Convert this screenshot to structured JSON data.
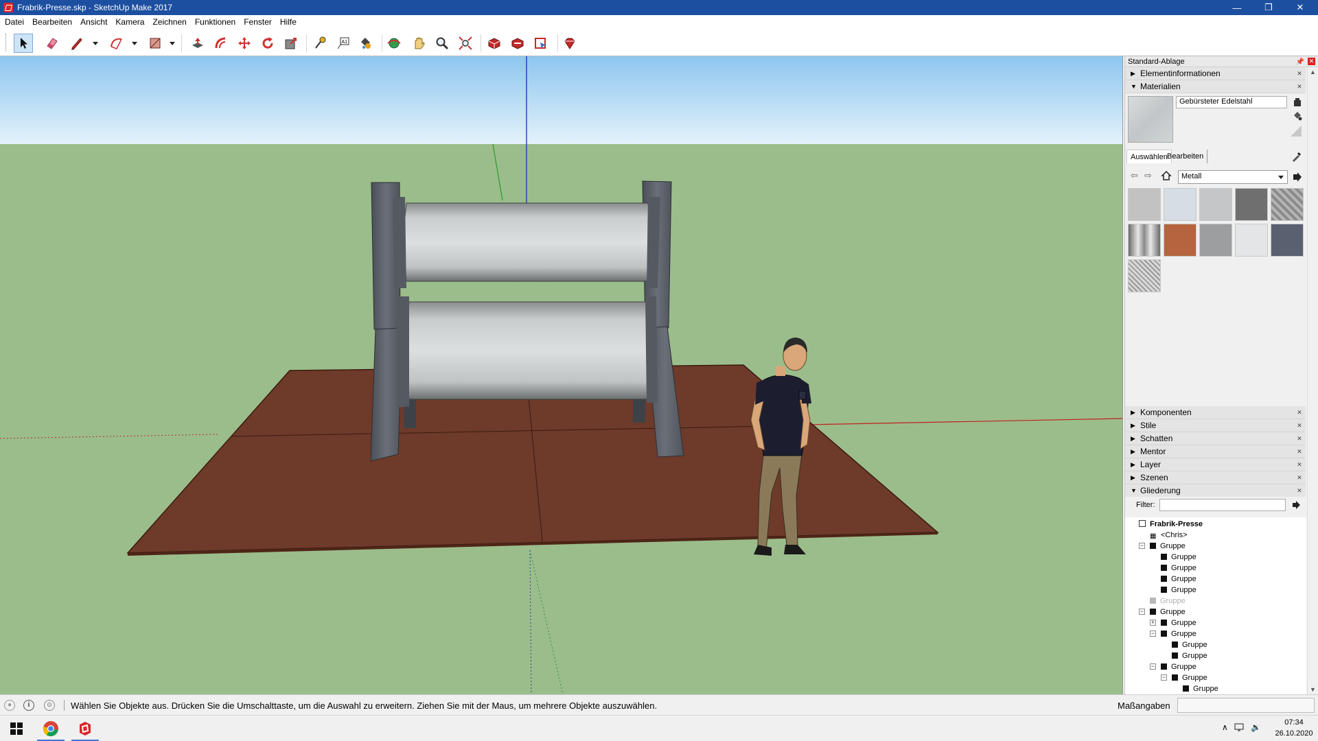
{
  "window": {
    "title": "Frabrik-Presse.skp - SketchUp Make 2017",
    "controls": {
      "minimize": "—",
      "restore": "❐",
      "close": "✕"
    }
  },
  "menu": [
    "Datei",
    "Bearbeiten",
    "Ansicht",
    "Kamera",
    "Zeichnen",
    "Funktionen",
    "Fenster",
    "Hilfe"
  ],
  "toolbar": {
    "tools": [
      "select-tool",
      "eraser-tool",
      "line-tool",
      "arc-tool",
      "rectangle-tool",
      "push-pull-tool",
      "offset-tool",
      "move-tool",
      "rotate-tool",
      "scale-tool",
      "tape-measure-tool",
      "text-tool",
      "paint-bucket-tool",
      "orbit-tool",
      "pan-tool",
      "zoom-tool",
      "zoom-extents-tool",
      "3d-warehouse",
      "extension-warehouse",
      "layout",
      "extension-manager"
    ],
    "active_tool": "select-tool"
  },
  "tray": {
    "title": "Standard-Ablage",
    "panels_top": [
      {
        "label": "Elementinformationen",
        "expanded": false
      },
      {
        "label": "Materialien",
        "expanded": true
      }
    ],
    "materials": {
      "current_name": "Gebürsteter Edelstahl",
      "tabs": [
        "Auswählen",
        "Bearbeiten"
      ],
      "selected_tab": "Auswählen",
      "collection": "Metall",
      "swatches": [
        {
          "name": "aluminum",
          "color": "#c2c2c2"
        },
        {
          "name": "chrome-light",
          "color": "#d6dde4"
        },
        {
          "name": "steel-light",
          "color": "#c4c6c8"
        },
        {
          "name": "steel-dark",
          "color": "#6f6f6f"
        },
        {
          "name": "diamond-plate",
          "color": "#9a9a9a"
        },
        {
          "name": "corrugated",
          "color": "#a5a5a5"
        },
        {
          "name": "rust",
          "color": "#b5643f"
        },
        {
          "name": "steel-textured",
          "color": "#9c9ea0"
        },
        {
          "name": "white-metal",
          "color": "#e4e5e6"
        },
        {
          "name": "blue-steel",
          "color": "#5a6070"
        },
        {
          "name": "metal-mesh",
          "color": "#b9b9b9"
        }
      ]
    },
    "panels_bottom": [
      {
        "label": "Komponenten",
        "expanded": false
      },
      {
        "label": "Stile",
        "expanded": false
      },
      {
        "label": "Schatten",
        "expanded": false
      },
      {
        "label": "Mentor",
        "expanded": false
      },
      {
        "label": "Layer",
        "expanded": false
      },
      {
        "label": "Szenen",
        "expanded": false
      },
      {
        "label": "Gliederung",
        "expanded": true
      }
    ],
    "outliner": {
      "filter_label": "Filter:",
      "filter_value": "",
      "nodes": [
        {
          "label": "Frabrik-Presse",
          "depth": 0,
          "kind": "root"
        },
        {
          "label": "<Chris>",
          "depth": 1,
          "kind": "component"
        },
        {
          "label": "Gruppe",
          "depth": 1,
          "kind": "group",
          "expander": "-"
        },
        {
          "label": "Gruppe",
          "depth": 2,
          "kind": "group"
        },
        {
          "label": "Gruppe",
          "depth": 2,
          "kind": "group"
        },
        {
          "label": "Gruppe",
          "depth": 2,
          "kind": "group"
        },
        {
          "label": "Gruppe",
          "depth": 2,
          "kind": "group"
        },
        {
          "label": "Gruppe",
          "depth": 1,
          "kind": "group",
          "hidden": true
        },
        {
          "label": "Gruppe",
          "depth": 1,
          "kind": "group",
          "expander": "-"
        },
        {
          "label": "Gruppe",
          "depth": 2,
          "kind": "group",
          "expander": "+"
        },
        {
          "label": "Gruppe",
          "depth": 2,
          "kind": "group",
          "expander": "-"
        },
        {
          "label": "Gruppe",
          "depth": 3,
          "kind": "group"
        },
        {
          "label": "Gruppe",
          "depth": 3,
          "kind": "group"
        },
        {
          "label": "Gruppe",
          "depth": 2,
          "kind": "group",
          "expander": "-"
        },
        {
          "label": "Gruppe",
          "depth": 3,
          "kind": "group",
          "expander": "-"
        },
        {
          "label": "Gruppe",
          "depth": 4,
          "kind": "group"
        }
      ]
    }
  },
  "status": {
    "message": "Wählen Sie Objekte aus. Drücken Sie die Umschalttaste, um die Auswahl zu erweitern. Ziehen Sie mit der Maus, um mehrere Objekte auszuwählen.",
    "measurements_label": "Maßangaben",
    "measurements_value": ""
  },
  "taskbar": {
    "apps": [
      "chrome",
      "sketchup"
    ],
    "time": "07:34",
    "date": "26.10.2020"
  },
  "colors": {
    "titlebar": "#1c4fa0",
    "sky": "#b4def4",
    "ground": "#9bbd8b",
    "floor": "#6e3a2a",
    "frame": "#5c6068",
    "roller": "#c9cccc"
  }
}
